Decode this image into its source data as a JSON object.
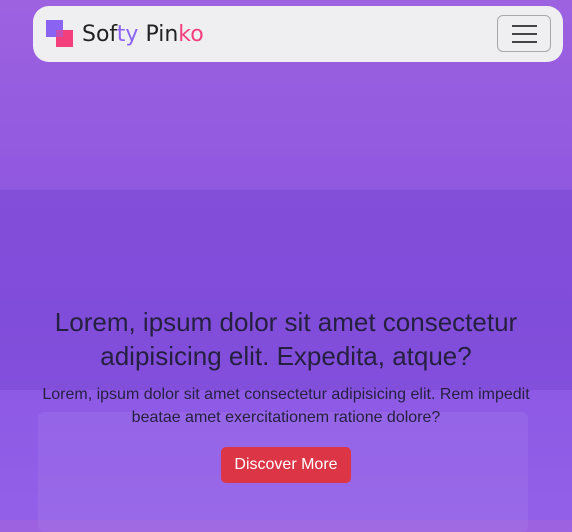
{
  "navbar": {
    "brand_part1": "Sof",
    "brand_part2": "ty",
    "brand_part3": " Pin",
    "brand_part4": "ko",
    "toggler_icon": "hamburger-menu-icon",
    "colors": {
      "accent_purple": "#8b63f3",
      "accent_pink": "#f3407c"
    }
  },
  "hero": {
    "heading": "Lorem, ipsum dolor sit amet consectetur adipisicing elit. Expedita, atque?",
    "text": "Lorem, ipsum dolor sit amet consectetur adipisicing elit. Rem impedit beatae amet exercitationem ratione dolore?",
    "button_label": "Discover More",
    "button_color": "#dc3545"
  }
}
